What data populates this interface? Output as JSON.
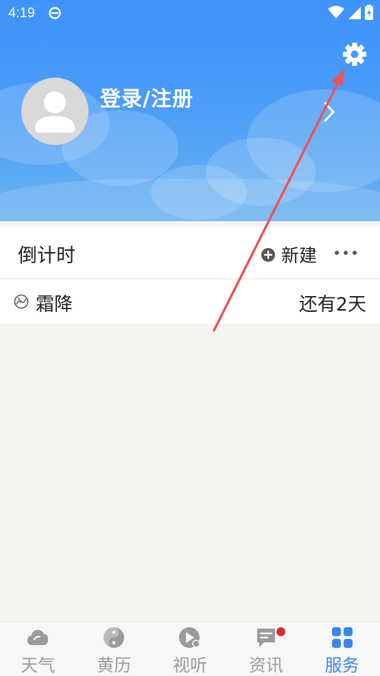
{
  "status_bar": {
    "time": "4:19"
  },
  "header": {
    "login_label": "登录/注册"
  },
  "countdown": {
    "title": "倒计时",
    "new_label": "新建"
  },
  "events": [
    {
      "name": "霜降",
      "remaining": "还有2天"
    }
  ],
  "bottom_nav": {
    "items": [
      {
        "label": "天气"
      },
      {
        "label": "黄历"
      },
      {
        "label": "视听"
      },
      {
        "label": "资讯"
      },
      {
        "label": "服务"
      }
    ],
    "active_index": 4
  },
  "colors": {
    "header_blue": "#3f93fa",
    "active_tab": "#3b86e8",
    "badge_red": "#d32f2f",
    "annotation_arrow": "#e8545a"
  }
}
